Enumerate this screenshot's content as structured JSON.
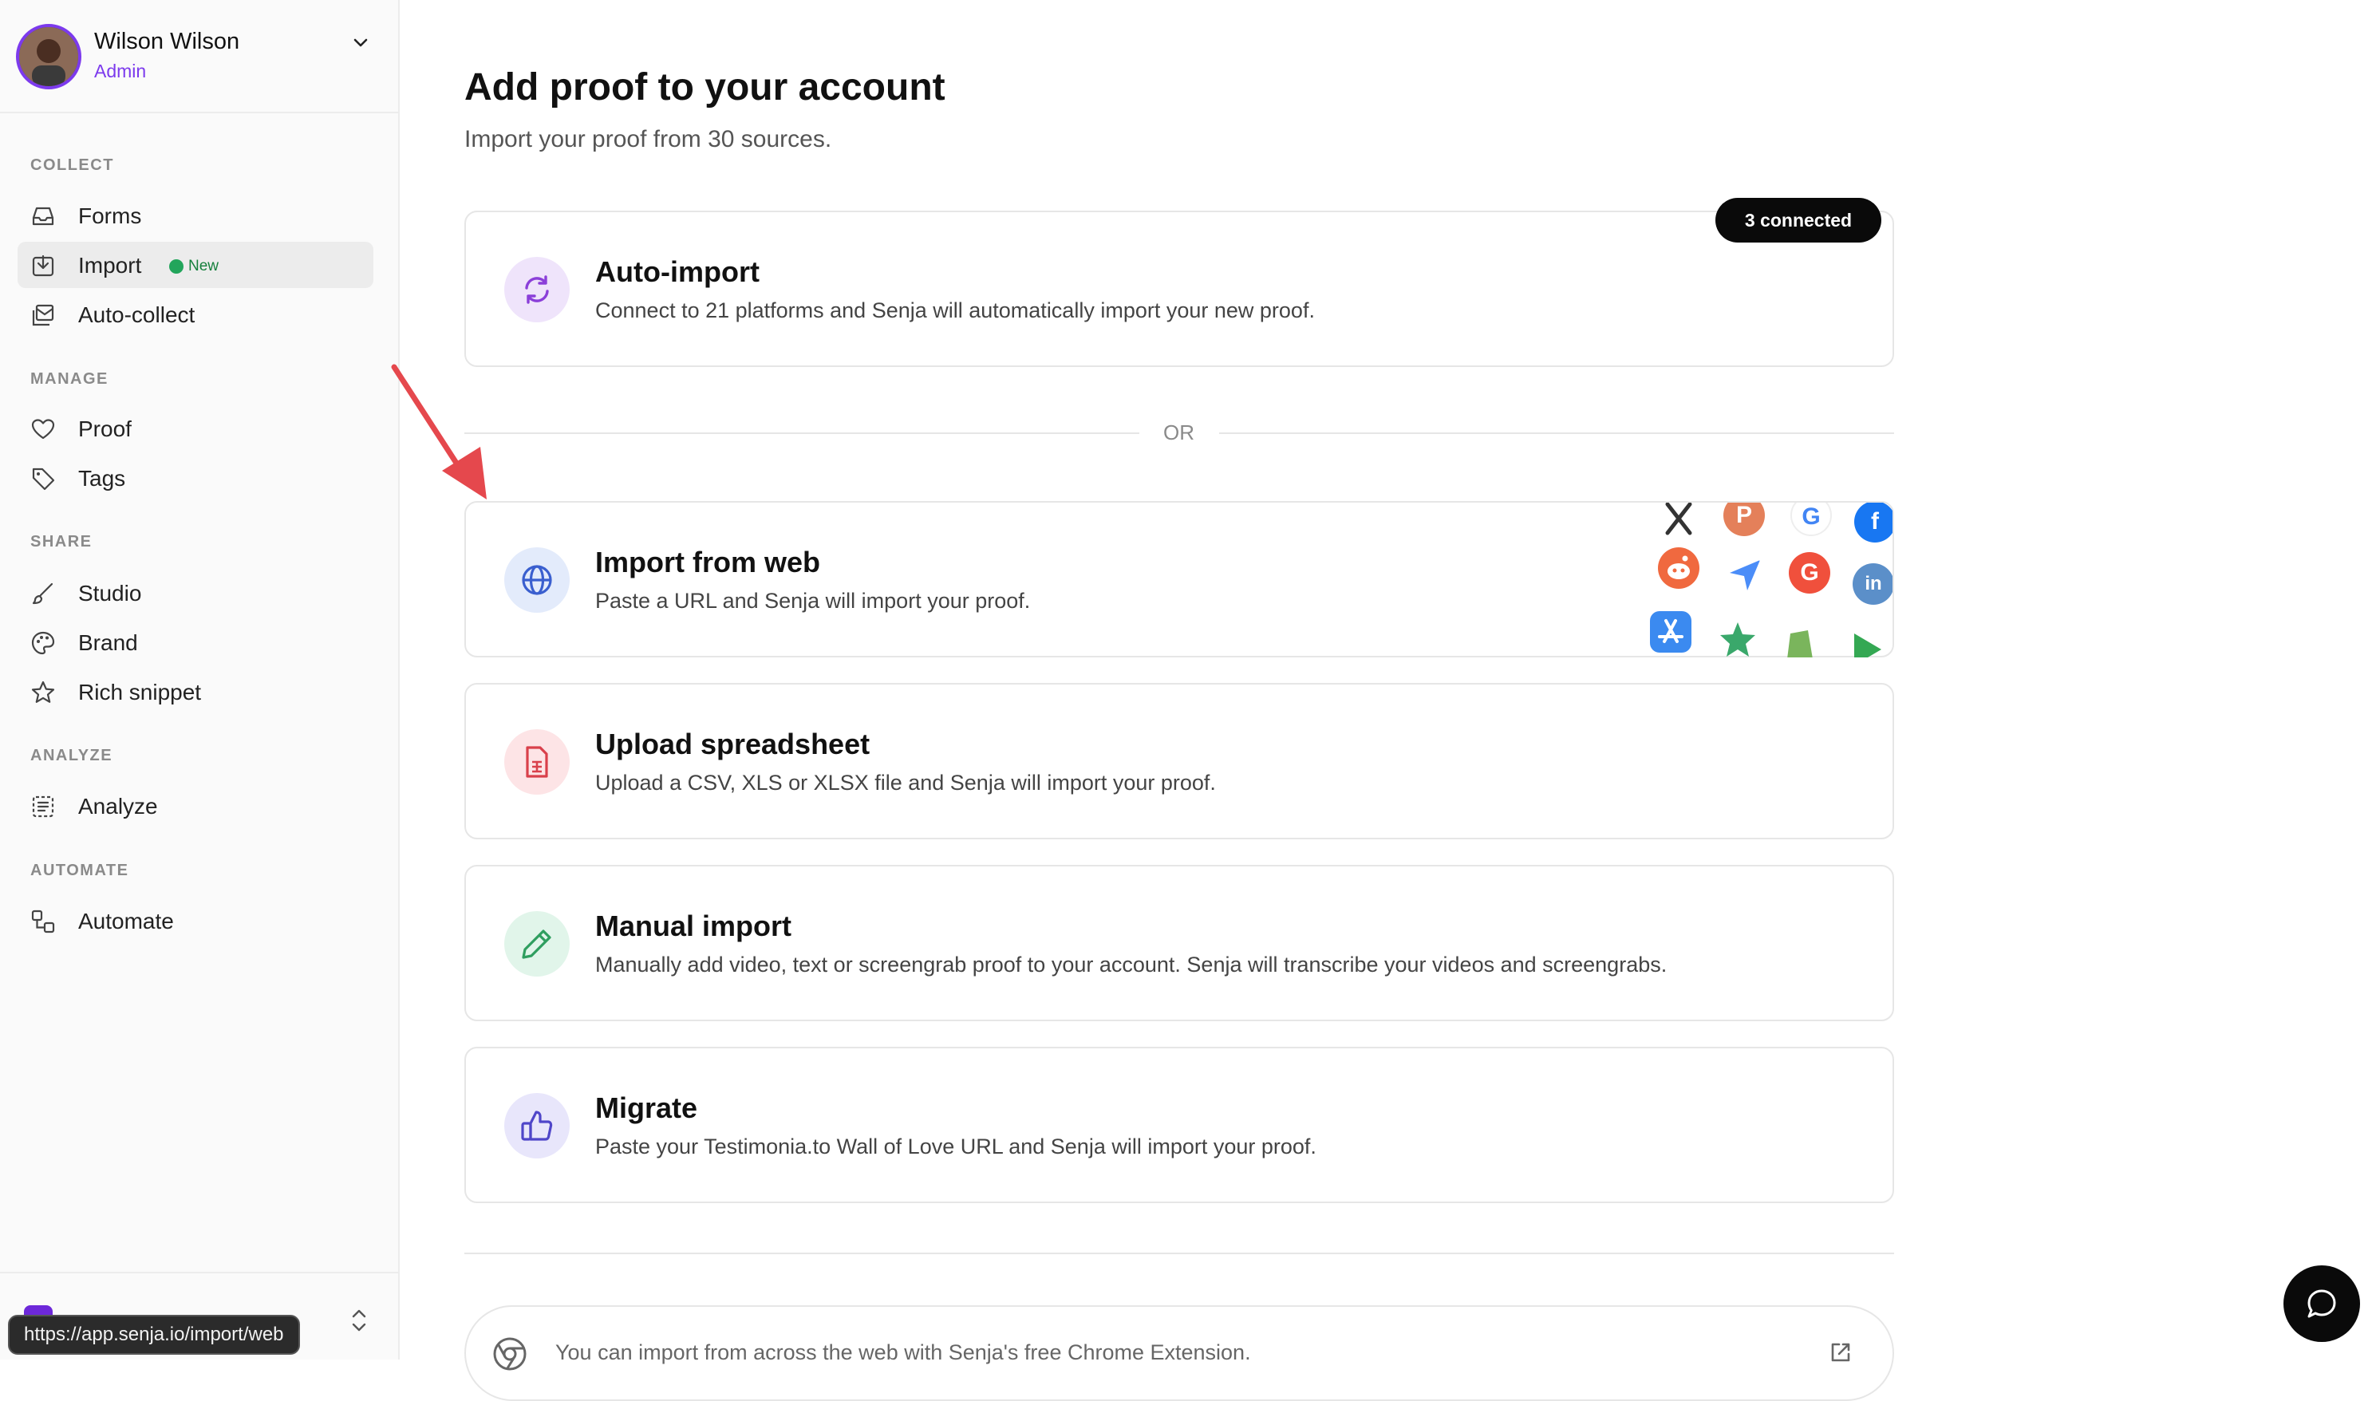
{
  "user": {
    "name": "Wilson Wilson",
    "role": "Admin"
  },
  "sidebar": {
    "sections": {
      "collect": "COLLECT",
      "manage": "MANAGE",
      "share": "SHARE",
      "analyze": "ANALYZE",
      "automate": "AUTOMATE"
    },
    "items": {
      "forms": "Forms",
      "import": "Import",
      "import_badge": "New",
      "auto_collect": "Auto-collect",
      "proof": "Proof",
      "tags": "Tags",
      "studio": "Studio",
      "brand": "Brand",
      "rich_snippet": "Rich snippet",
      "analyze": "Analyze",
      "automate": "Automate"
    },
    "active_item": "Import"
  },
  "status_url": "https://app.senja.io/import/web",
  "main": {
    "title": "Add proof to your account",
    "subtitle": "Import your proof from 30 sources.",
    "connected_badge": "3 connected",
    "or_label": "OR",
    "cards": {
      "auto_import": {
        "title": "Auto-import",
        "desc": "Connect to 21 platforms and Senja will automatically import your new proof."
      },
      "import_web": {
        "title": "Import from web",
        "desc": "Paste a URL and Senja will import your proof."
      },
      "spreadsheet": {
        "title": "Upload spreadsheet",
        "desc": "Upload a CSV, XLS or XLSX file and Senja will import your proof."
      },
      "manual": {
        "title": "Manual import",
        "desc": "Manually add video, text or screengrab proof to your account. Senja will transcribe your videos and screengrabs."
      },
      "migrate": {
        "title": "Migrate",
        "desc": "Paste your Testimonia.to Wall of Love URL and Senja will import your proof."
      }
    },
    "extension_text": "You can import from across the web with Senja's free Chrome Extension."
  },
  "logo_letters": {
    "producthunt": "P",
    "google": "G",
    "facebook": "f",
    "linkedin": "in",
    "g2": "G"
  },
  "colors": {
    "accent": "#7c3aed",
    "new_badge": "#16803d",
    "arrow": "#e5484d",
    "auto_import_icon_bg": "#efe4fb",
    "web_icon_bg": "#e3ebfb",
    "spreadsheet_icon_bg": "#fde4e6",
    "manual_icon_bg": "#e1f5ea",
    "migrate_icon_bg": "#e8e6fb"
  }
}
